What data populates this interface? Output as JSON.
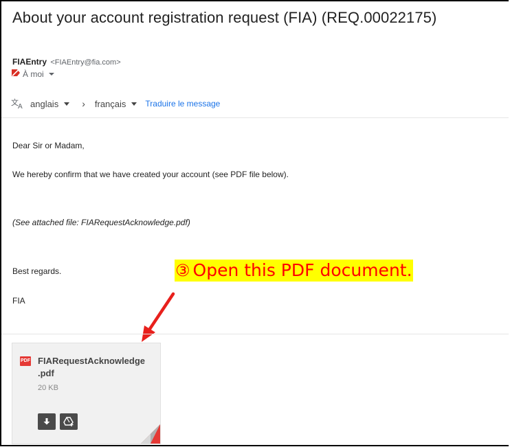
{
  "email": {
    "subject": "About your account registration request (FIA) (REQ.00022175)",
    "sender_name": "FIAEntry",
    "sender_email": "<FIAEntry@fia.com>",
    "recipient": "À moi",
    "translate": {
      "source_lang": "anglais",
      "target_lang": "français",
      "action": "Traduire le message"
    },
    "body": {
      "greeting": "Dear Sir or Madam,",
      "confirmation": "We hereby confirm that we have created your account (see PDF file below).",
      "attachment_note": "(See attached file: FIARequestAcknowledge.pdf)",
      "closing": "Best regards.",
      "signature": "FIA"
    }
  },
  "attachment": {
    "type_badge": "PDF",
    "file_name": "FIARequestAcknowledge.pdf",
    "file_size": "20 KB"
  },
  "annotation": {
    "step_number": "③",
    "text": "Open this PDF document."
  },
  "colors": {
    "link": "#1a73e8",
    "annotation_text": "#ff0000",
    "annotation_highlight": "#ffff00",
    "arrow": "#e8201c",
    "pdf_badge": "#e53935"
  }
}
